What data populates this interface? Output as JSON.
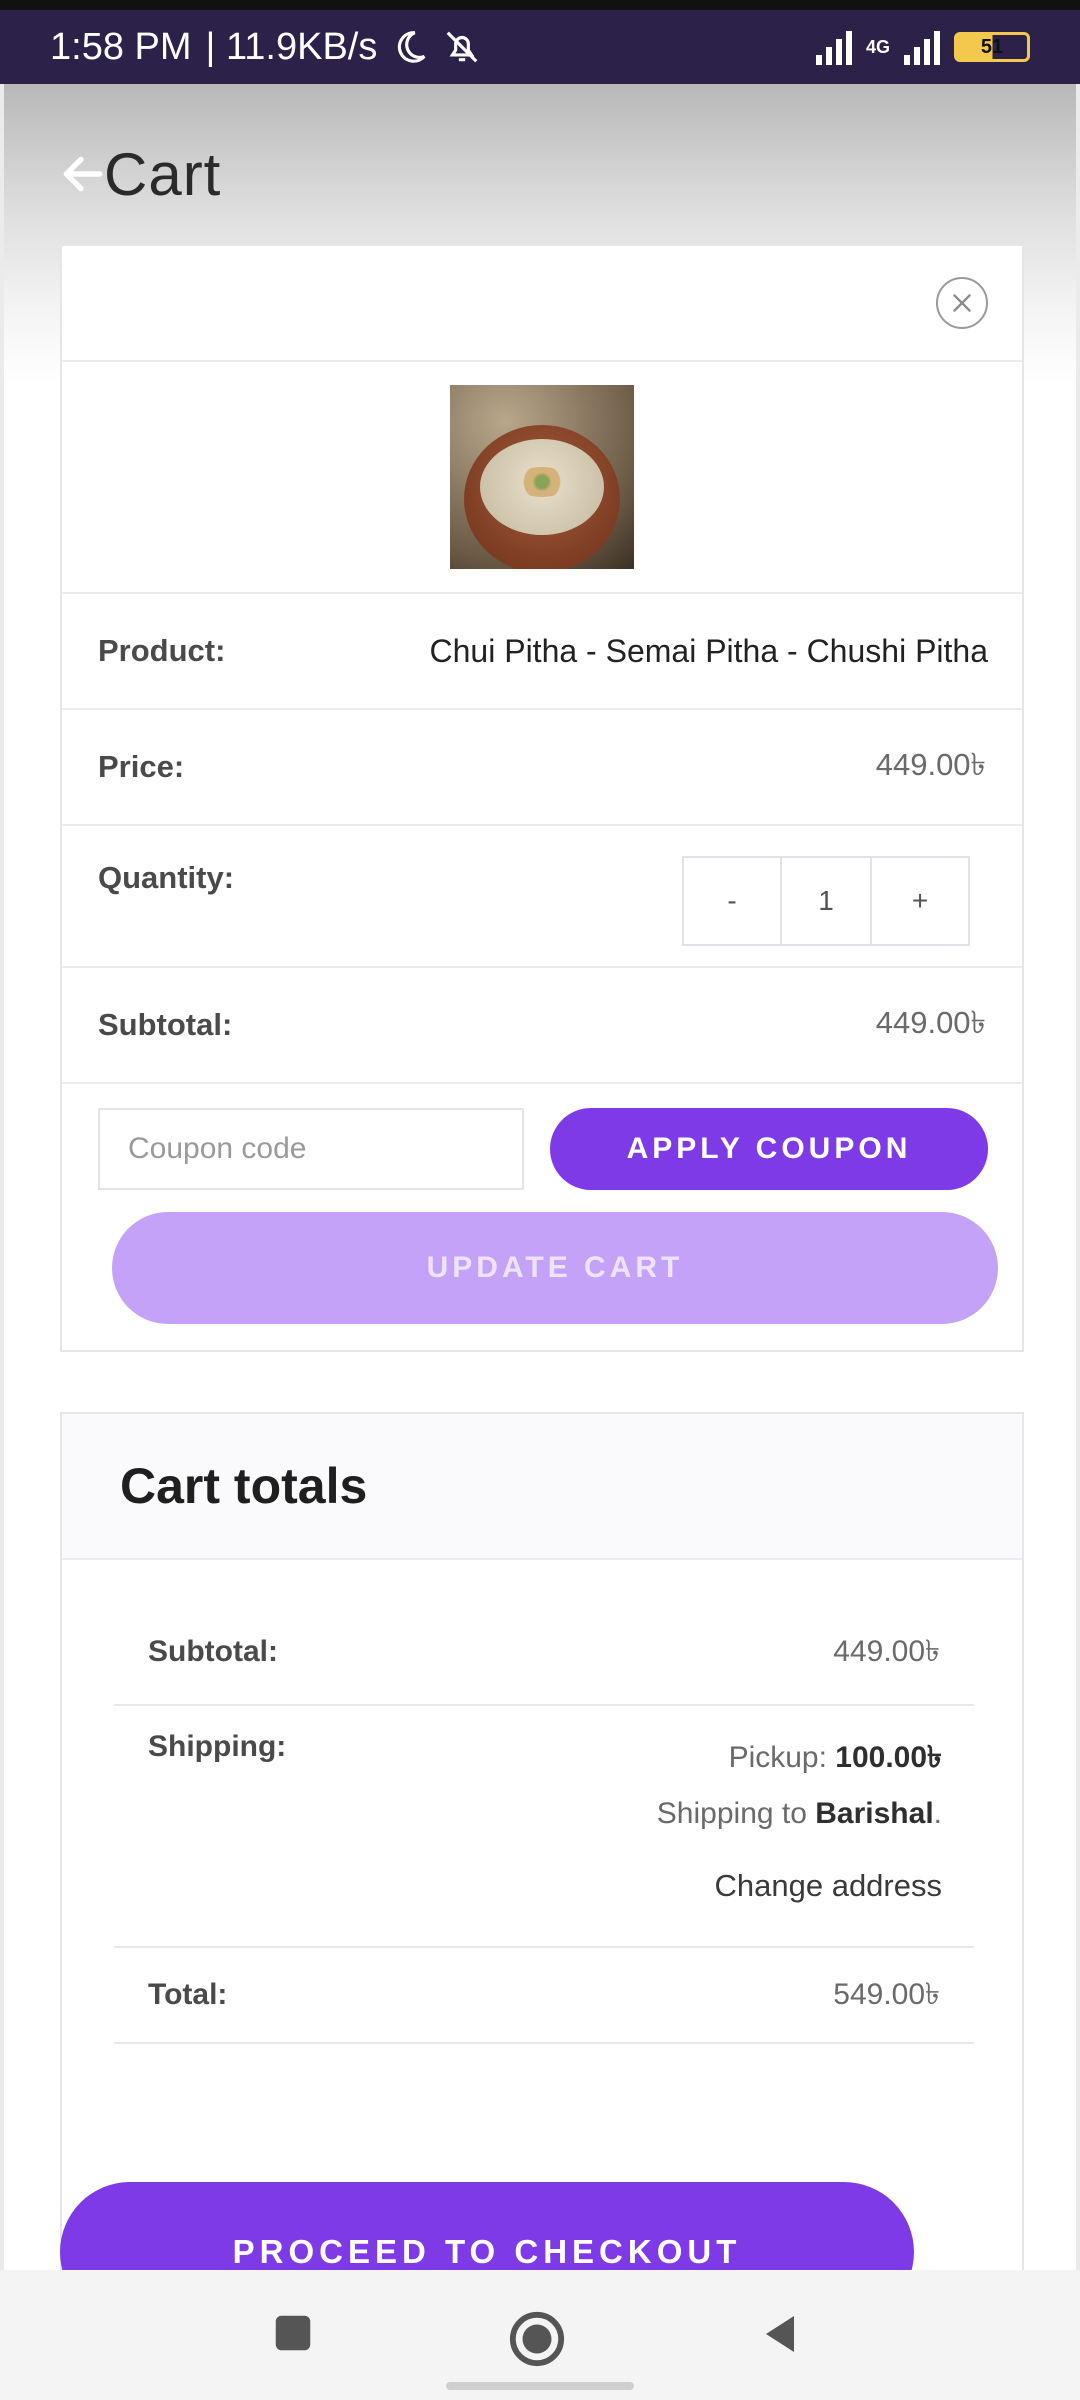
{
  "status_bar": {
    "time": "1:58 PM",
    "net_speed": "| 11.9KB/s",
    "network_type": "4G",
    "battery": "51"
  },
  "header": {
    "title": "Cart"
  },
  "cart_item": {
    "product_label": "Product:",
    "product_name": "Chui Pitha - Semai Pitha - Chushi Pitha",
    "price_label": "Price:",
    "price": "449.00৳",
    "quantity_label": "Quantity:",
    "quantity_decrement": "-",
    "quantity": "1",
    "quantity_increment": "+",
    "subtotal_label": "Subtotal:",
    "subtotal": "449.00৳"
  },
  "coupon": {
    "placeholder": "Coupon code",
    "apply_label": "APPLY COUPON",
    "update_label": "UPDATE CART"
  },
  "totals": {
    "title": "Cart totals",
    "subtotal_label": "Subtotal:",
    "subtotal": "449.00৳",
    "shipping_label": "Shipping:",
    "pickup_prefix": "Pickup:",
    "pickup_amount": "100.00৳",
    "shipping_to_prefix": "Shipping to",
    "shipping_to_place": "Barishal",
    "shipping_to_suffix": ".",
    "change_address": "Change address",
    "total_label": "Total:",
    "total": "549.00৳",
    "checkout_label": "PROCEED TO CHECKOUT"
  },
  "icons": {
    "back": "back-arrow-icon",
    "close": "close-circle-icon",
    "nav_recents": "square-icon",
    "nav_home": "circle-icon",
    "nav_back": "triangle-back-icon"
  },
  "colors": {
    "accent": "#7e3ae6",
    "accent_light": "#c4a2f7",
    "status_bar": "#2b2149"
  }
}
